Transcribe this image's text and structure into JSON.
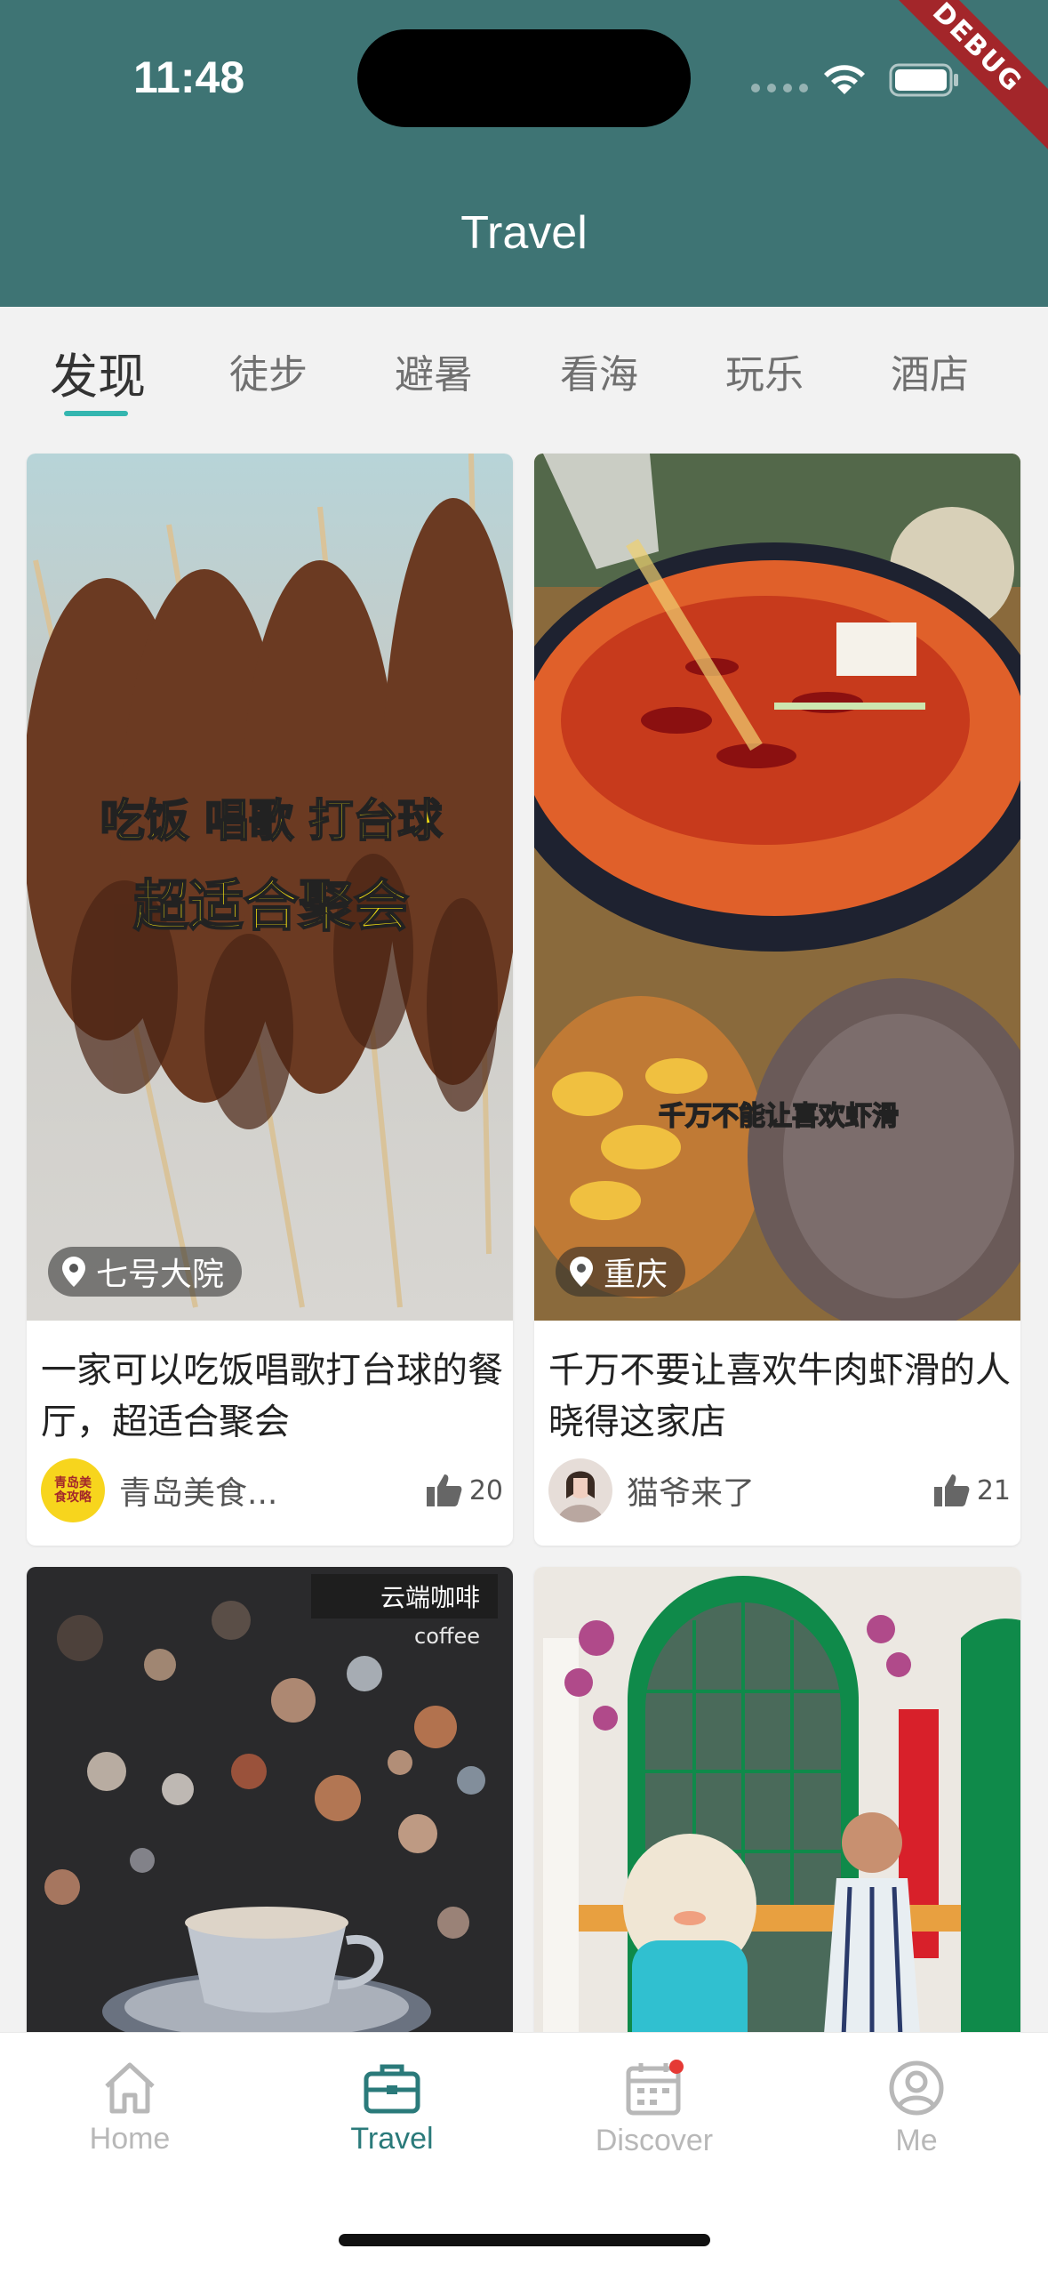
{
  "status_bar": {
    "time": "11:48"
  },
  "debug_banner": "DEBUG",
  "app_bar": {
    "title": "Travel"
  },
  "tabs": [
    {
      "label": "发现",
      "active": true
    },
    {
      "label": "徒步",
      "active": false
    },
    {
      "label": "避暑",
      "active": false
    },
    {
      "label": "看海",
      "active": false
    },
    {
      "label": "玩乐",
      "active": false
    },
    {
      "label": "酒店",
      "active": false
    }
  ],
  "cards": [
    {
      "location": "七号大院",
      "image_caption_line1": "吃饭 唱歌 打台球",
      "image_caption_line2": "超适合聚会",
      "title": "一家可以吃饭唱歌打台球的餐厅，超适合聚会",
      "user": "青岛美食...",
      "avatar_text": "青岛美食攻略",
      "likes": "20"
    },
    {
      "location": "重庆",
      "image_caption": "千万不能让喜欢虾滑",
      "title": "千万不要让喜欢牛肉虾滑的人晓得这家店",
      "user": "猫爷来了",
      "likes": "21"
    },
    {
      "image_caption": "云端咖啡",
      "image_subcaption": "coffee"
    },
    {}
  ],
  "bottom_nav": [
    {
      "label": "Home",
      "icon": "home-icon",
      "active": false
    },
    {
      "label": "Travel",
      "icon": "briefcase-icon",
      "active": true
    },
    {
      "label": "Discover",
      "icon": "calendar-icon",
      "active": false,
      "badge": true
    },
    {
      "label": "Me",
      "icon": "profile-icon",
      "active": false
    }
  ],
  "colors": {
    "header": "#3e7474",
    "tab_indicator": "#34b6b0",
    "active_nav": "#2a7a7a",
    "badge": "#e53935"
  }
}
